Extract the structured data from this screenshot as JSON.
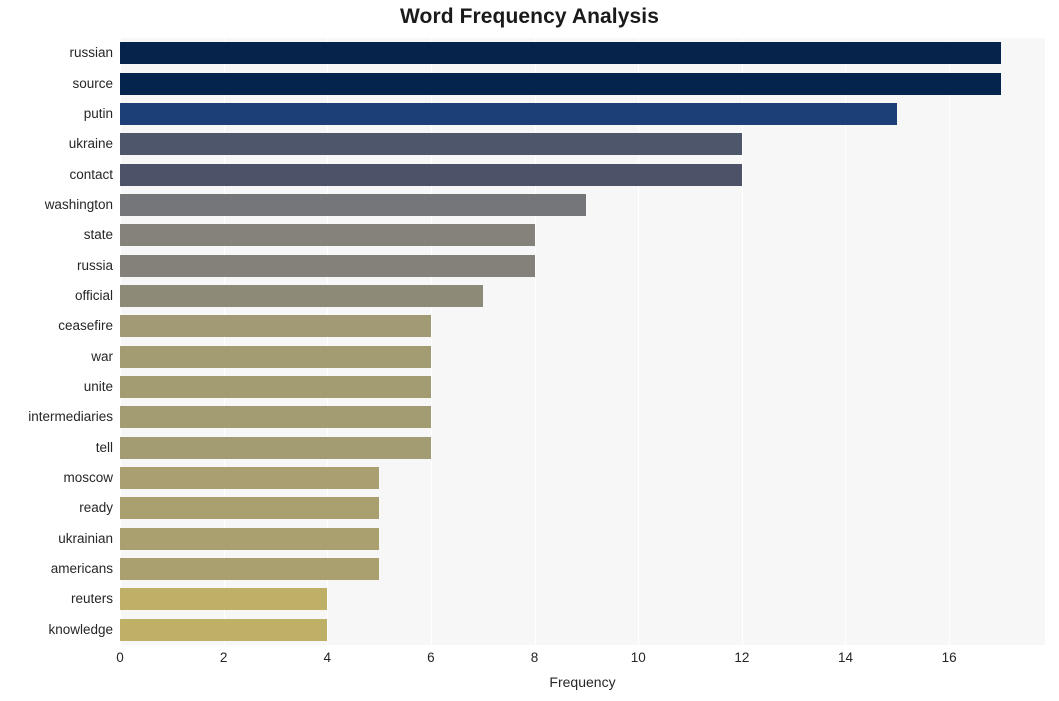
{
  "chart_data": {
    "type": "bar",
    "orientation": "horizontal",
    "title": "Word Frequency Analysis",
    "xlabel": "Frequency",
    "ylabel": "",
    "categories": [
      "russian",
      "source",
      "putin",
      "ukraine",
      "contact",
      "washington",
      "state",
      "russia",
      "official",
      "ceasefire",
      "war",
      "unite",
      "intermediaries",
      "tell",
      "moscow",
      "ready",
      "ukrainian",
      "americans",
      "reuters",
      "knowledge"
    ],
    "values": [
      17,
      17,
      15,
      12,
      12,
      9,
      8,
      8,
      7,
      6,
      6,
      6,
      6,
      6,
      5,
      5,
      5,
      5,
      4,
      4
    ],
    "bar_colors": [
      "#05234b",
      "#04244d",
      "#1d3f78",
      "#4e566b",
      "#4d5268",
      "#75767a",
      "#85827c",
      "#84817b",
      "#8e8a78",
      "#a19a74",
      "#a39c73",
      "#a39c73",
      "#a39c73",
      "#a39c73",
      "#a99f70",
      "#aaa06f",
      "#aaa06f",
      "#aaa06f",
      "#bfb067",
      "#bfb067"
    ],
    "xticks": [
      0,
      2,
      4,
      6,
      8,
      10,
      12,
      14,
      16
    ],
    "xtick_labels": [
      "0",
      "2",
      "4",
      "6",
      "8",
      "10",
      "12",
      "14",
      "16"
    ],
    "xlim": [
      0,
      17.85
    ],
    "grid": true,
    "grid_color": "#ffffff",
    "plot_background": "#f7f7f7",
    "figure_background": "#ffffff",
    "legend": null,
    "title_color": "#1a1a1a",
    "tick_label_color": "#262626"
  }
}
